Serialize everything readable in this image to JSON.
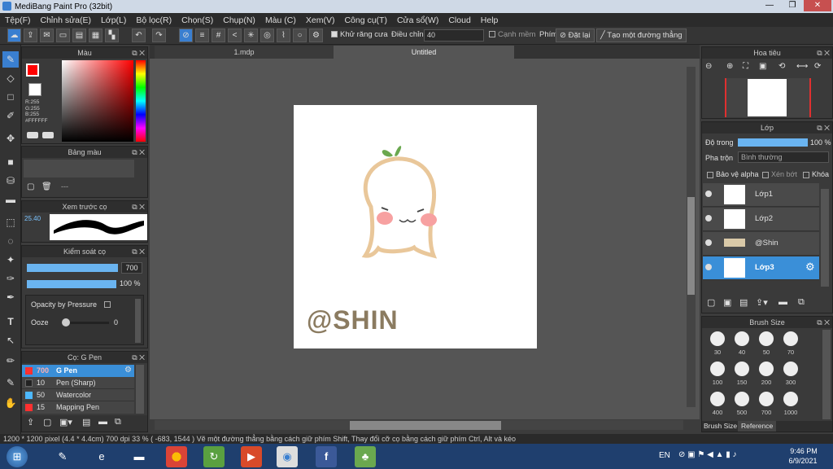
{
  "window": {
    "title": "MediBang Paint Pro (32bit)",
    "minimize": "—",
    "restore": "❐",
    "close": "✕"
  },
  "menu": [
    "Tệp(F)",
    "Chỉnh sửa(E)",
    "Lớp(L)",
    "Bộ lọc(R)",
    "Chọn(S)",
    "Chụp(N)",
    "Màu (C)",
    "Xem(V)",
    "Công cụ(T)",
    "Cửa sổ(W)",
    "Cloud",
    "Help"
  ],
  "toolbar": {
    "antialias": "Khử răng cưa",
    "correction_label": "Điều chỉnh",
    "correction_value": "40",
    "edge_label": "Cạnh mềm",
    "pen_label": "Phím",
    "reset": "Đặt lại",
    "straight_line": "Tạo một đường thẳng"
  },
  "tabs": [
    "1.mdp",
    "Untitled"
  ],
  "color_panel": {
    "title": "Màu",
    "r": "R:255",
    "g": "G:255",
    "b": "B:255",
    "hex": "#FFFFFF",
    "primary": "#ff0000",
    "secondary": "#ffffff"
  },
  "palette_panel": {
    "title": "Bảng màu",
    "dash": "---"
  },
  "brush_preview": {
    "title": "Xem trước cọ",
    "size": "25.40"
  },
  "brush_control": {
    "title": "Kiểm soát cọ",
    "size_value": "700",
    "opacity_value": "100 %",
    "opacity_pressure": "Opacity by Pressure",
    "ooze": "Ooze",
    "ooze_value": "0"
  },
  "brush_list": {
    "title": "Cọ: G Pen",
    "items": [
      {
        "size": "700",
        "name": "G Pen",
        "color": "#ff3030"
      },
      {
        "size": "10",
        "name": "Pen (Sharp)",
        "color": "#222222"
      },
      {
        "size": "50",
        "name": "Watercolor",
        "color": "#4db8ff"
      },
      {
        "size": "15",
        "name": "Mapping Pen",
        "color": "#ff3030"
      }
    ]
  },
  "navigator": {
    "title": "Hoa tiêu"
  },
  "layer_panel": {
    "title": "Lớp",
    "opacity_label": "Độ trong",
    "opacity_value": "100 %",
    "blend_label": "Pha trộn",
    "blend_value": "Bình thường",
    "protect_alpha": "Bảo vệ alpha",
    "clipping": "Xén bớt",
    "lock": "Khóa",
    "layers": [
      "Lớp1",
      "Lớp2",
      "@Shin",
      "Lớp3"
    ]
  },
  "brush_size_panel": {
    "title": "Brush Size",
    "sizes": [
      "30",
      "40",
      "50",
      "70",
      "100",
      "150",
      "200",
      "300",
      "400",
      "500",
      "700",
      "1000"
    ],
    "tab1": "Brush Size",
    "tab2": "Reference"
  },
  "canvas": {
    "watermark": "@SHIN"
  },
  "status": "1200 * 1200 pixel   (4.4 * 4.4cm)   700 dpi   33 %   ( -683, 1544 )   Vẽ một đường thẳng bằng cách giữ phím Shift, Thay đổi cỡ cọ bằng cách giữ phím Ctrl, Alt và kéo",
  "taskbar": {
    "lang": "EN",
    "time": "9:46 PM",
    "date": "6/9/2021"
  }
}
